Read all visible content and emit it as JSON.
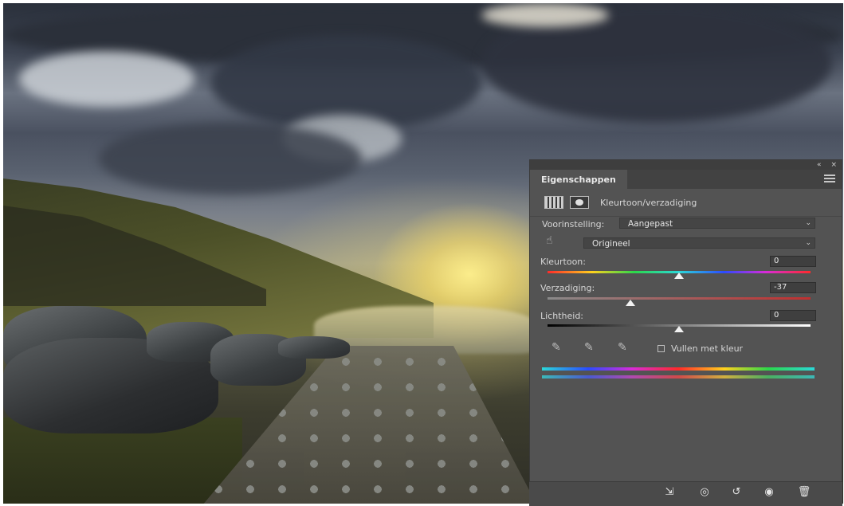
{
  "panel": {
    "title": "Eigenschappen",
    "collapse_glyph": "«",
    "close_glyph": "×",
    "adjustment_name": "Kleurtoon/verzadiging",
    "preset_label": "Voorinstelling:",
    "preset_value": "Aangepast",
    "channel_value": "Origineel",
    "hue": {
      "label": "Kleurtoon:",
      "value": "0",
      "fraction": 0.5
    },
    "saturation": {
      "label": "Verzadiging:",
      "value": "-37",
      "fraction": 0.315
    },
    "lightness": {
      "label": "Lichtheid:",
      "value": "0",
      "fraction": 0.5
    },
    "colorize_label": "Vullen met kleur",
    "colorize_checked": false
  },
  "footer_icons": [
    "clip-to-layer-icon",
    "view-previous-state-icon",
    "reset-icon",
    "visibility-eye-icon",
    "trash-icon"
  ],
  "colors": {
    "panel_bg": "#535353",
    "tab_bar": "#424242",
    "field_bg": "#454545"
  }
}
